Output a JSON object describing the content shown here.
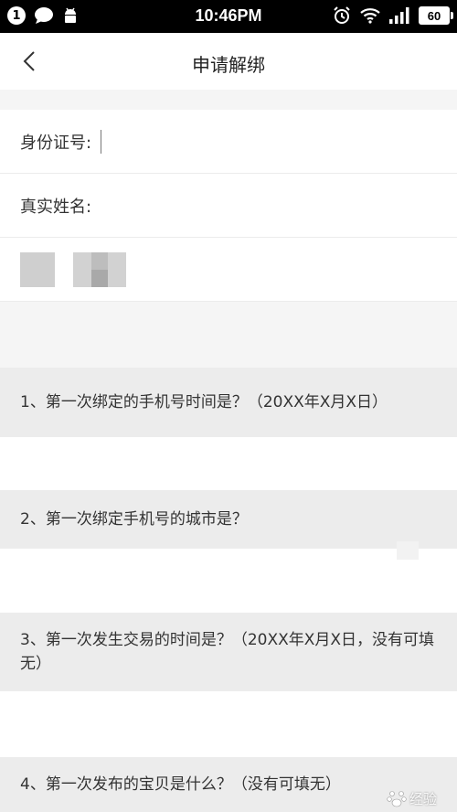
{
  "status_bar": {
    "notification_count": "1",
    "time": "10:46PM",
    "battery": "60",
    "icons": [
      "message-icon",
      "android-icon",
      "alarm-icon",
      "wifi-icon",
      "signal-icon"
    ]
  },
  "header": {
    "back_icon": "chevron-left-icon",
    "title": "申请解绑"
  },
  "form": {
    "id_label": "身份证号:",
    "name_label": "真实姓名:"
  },
  "questions": [
    {
      "label": "1、第一次绑定的手机号时间是？（20XX年X月X日）"
    },
    {
      "label": "2、第一次绑定手机号的城市是？"
    },
    {
      "label": "3、第一次发生交易的时间是？（20XX年X月X日，没有可填无）"
    },
    {
      "label": "4、第一次发布的宝贝是什么？（没有可填无）"
    }
  ],
  "watermark": {
    "text": "经验"
  },
  "colors": {
    "status_bar": "#000000",
    "section_bg": "#ececec",
    "page_bg": "#f5f5f5"
  }
}
